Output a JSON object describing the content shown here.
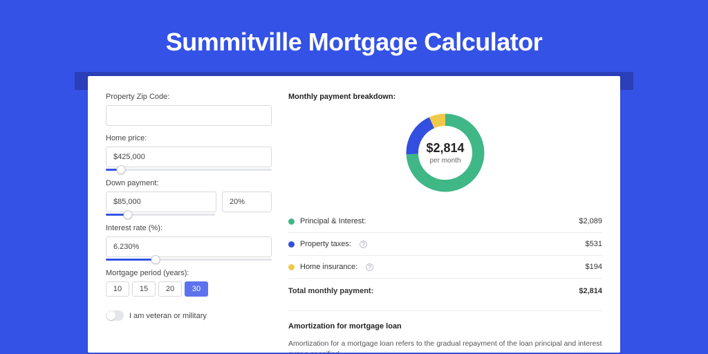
{
  "title": "Summitville Mortgage Calculator",
  "form": {
    "zip_label": "Property Zip Code:",
    "zip_value": "",
    "home_price_label": "Home price:",
    "home_price_value": "$425,000",
    "home_price_slider_fill_pct": 9,
    "down_payment_label": "Down payment:",
    "down_payment_value": "$85,000",
    "down_payment_pct_value": "20%",
    "down_payment_slider_fill_pct": 20,
    "interest_label": "Interest rate (%):",
    "interest_value": "6.230%",
    "interest_slider_fill_pct": 30,
    "period_label": "Mortgage period (years):",
    "periods": [
      "10",
      "15",
      "20",
      "30"
    ],
    "period_selected": "30",
    "veteran_label": "I am veteran or military",
    "veteran_on": false
  },
  "breakdown": {
    "title": "Monthly payment breakdown:",
    "center_amount": "$2,814",
    "center_sub": "per month",
    "items": [
      {
        "label": "Principal & Interest:",
        "value": "$2,089",
        "color": "#3fb786",
        "info": false
      },
      {
        "label": "Property taxes:",
        "value": "$531",
        "color": "#334fe0",
        "info": true
      },
      {
        "label": "Home insurance:",
        "value": "$194",
        "color": "#f0c94a",
        "info": true
      }
    ],
    "total_label": "Total monthly payment:",
    "total_value": "$2,814"
  },
  "chart_data": {
    "type": "pie",
    "title": "Monthly payment breakdown",
    "series": [
      {
        "name": "Principal & Interest",
        "value": 2089,
        "color": "#3fb786"
      },
      {
        "name": "Property taxes",
        "value": 531,
        "color": "#334fe0"
      },
      {
        "name": "Home insurance",
        "value": 194,
        "color": "#f0c94a"
      }
    ],
    "total": 2814,
    "center_label": "$2,814",
    "center_sub": "per month"
  },
  "amortization": {
    "title": "Amortization for mortgage loan",
    "body": "Amortization for a mortgage loan refers to the gradual repayment of the loan principal and interest over a specified"
  }
}
